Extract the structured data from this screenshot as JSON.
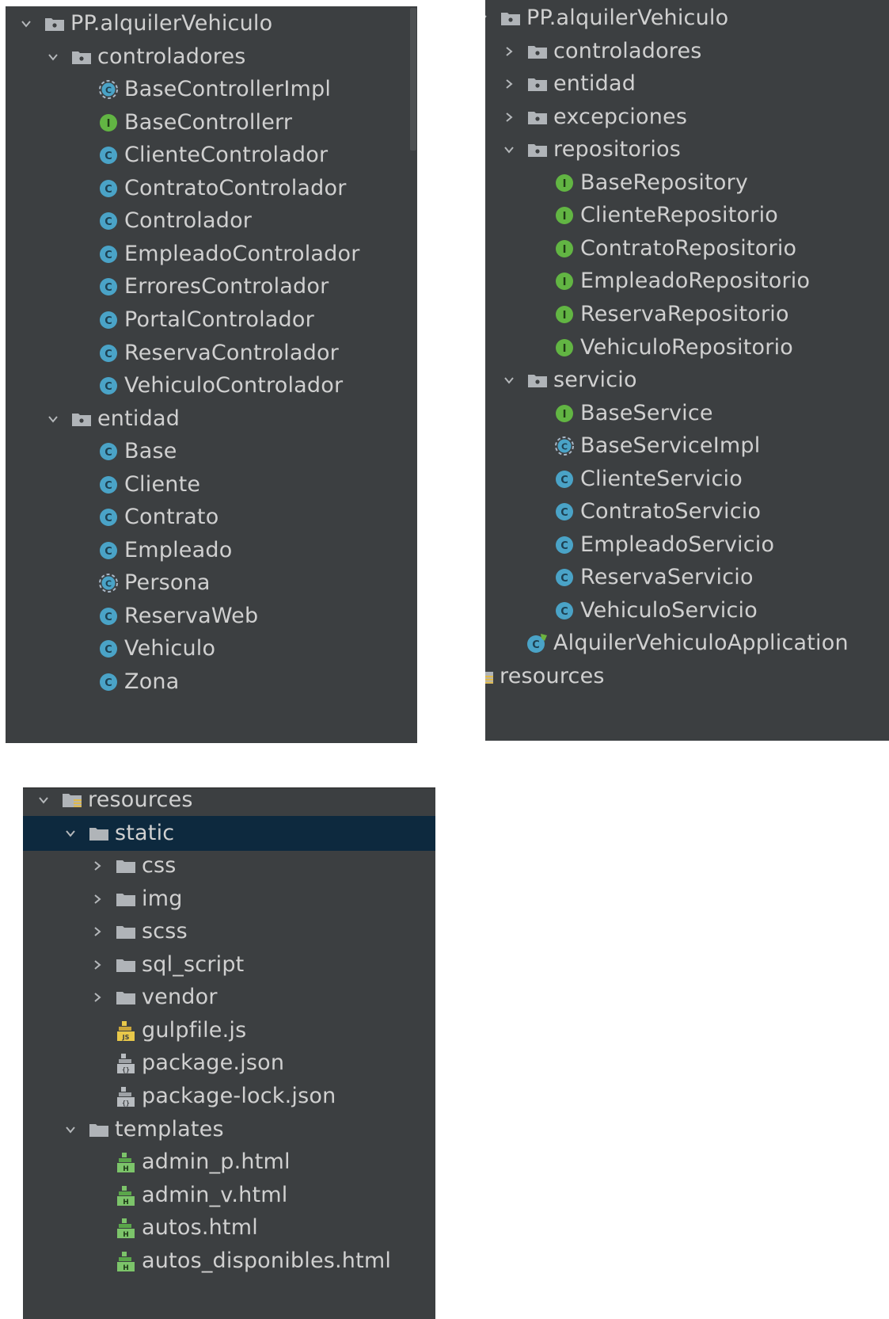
{
  "panels": {
    "left": [
      {
        "label": "PP.alquilerVehiculo",
        "icon": "package-folder-icon",
        "arrow": "down",
        "depth": 0
      },
      {
        "label": "controladores",
        "icon": "package-folder-icon",
        "arrow": "down",
        "depth": 1
      },
      {
        "label": "BaseControllerImpl",
        "icon": "abstract-class-icon",
        "arrow": "",
        "depth": 2
      },
      {
        "label": "BaseControllerr",
        "icon": "interface-icon",
        "arrow": "",
        "depth": 2
      },
      {
        "label": "ClienteControlador",
        "icon": "class-icon",
        "arrow": "",
        "depth": 2
      },
      {
        "label": "ContratoControlador",
        "icon": "class-icon",
        "arrow": "",
        "depth": 2
      },
      {
        "label": "Controlador",
        "icon": "class-icon",
        "arrow": "",
        "depth": 2
      },
      {
        "label": "EmpleadoControlador",
        "icon": "class-icon",
        "arrow": "",
        "depth": 2
      },
      {
        "label": "ErroresControlador",
        "icon": "class-icon",
        "arrow": "",
        "depth": 2
      },
      {
        "label": "PortalControlador",
        "icon": "class-icon",
        "arrow": "",
        "depth": 2
      },
      {
        "label": "ReservaControlador",
        "icon": "class-icon",
        "arrow": "",
        "depth": 2
      },
      {
        "label": "VehiculoControlador",
        "icon": "class-icon",
        "arrow": "",
        "depth": 2
      },
      {
        "label": "entidad",
        "icon": "package-folder-icon",
        "arrow": "down",
        "depth": 1
      },
      {
        "label": "Base",
        "icon": "class-icon",
        "arrow": "",
        "depth": 2
      },
      {
        "label": "Cliente",
        "icon": "class-icon",
        "arrow": "",
        "depth": 2
      },
      {
        "label": "Contrato",
        "icon": "class-icon",
        "arrow": "",
        "depth": 2
      },
      {
        "label": "Empleado",
        "icon": "class-icon",
        "arrow": "",
        "depth": 2
      },
      {
        "label": "Persona",
        "icon": "abstract-class-icon",
        "arrow": "",
        "depth": 2
      },
      {
        "label": "ReservaWeb",
        "icon": "class-icon",
        "arrow": "",
        "depth": 2
      },
      {
        "label": "Vehiculo",
        "icon": "class-icon",
        "arrow": "",
        "depth": 2
      },
      {
        "label": "Zona",
        "icon": "class-icon",
        "arrow": "",
        "depth": 2
      }
    ],
    "right": [
      {
        "label": "PP.alquilerVehiculo",
        "icon": "package-folder-icon",
        "arrow": "down",
        "depth": 0
      },
      {
        "label": "controladores",
        "icon": "package-folder-icon",
        "arrow": "right",
        "depth": 1
      },
      {
        "label": "entidad",
        "icon": "package-folder-icon",
        "arrow": "right",
        "depth": 1
      },
      {
        "label": "excepciones",
        "icon": "package-folder-icon",
        "arrow": "right",
        "depth": 1
      },
      {
        "label": "repositorios",
        "icon": "package-folder-icon",
        "arrow": "down",
        "depth": 1
      },
      {
        "label": "BaseRepository",
        "icon": "interface-icon",
        "arrow": "",
        "depth": 2
      },
      {
        "label": "ClienteRepositorio",
        "icon": "interface-icon",
        "arrow": "",
        "depth": 2
      },
      {
        "label": "ContratoRepositorio",
        "icon": "interface-icon",
        "arrow": "",
        "depth": 2
      },
      {
        "label": "EmpleadoRepositorio",
        "icon": "interface-icon",
        "arrow": "",
        "depth": 2
      },
      {
        "label": "ReservaRepositorio",
        "icon": "interface-icon",
        "arrow": "",
        "depth": 2
      },
      {
        "label": "VehiculoRepositorio",
        "icon": "interface-icon",
        "arrow": "",
        "depth": 2
      },
      {
        "label": "servicio",
        "icon": "package-folder-icon",
        "arrow": "down",
        "depth": 1
      },
      {
        "label": "BaseService",
        "icon": "interface-icon",
        "arrow": "",
        "depth": 2
      },
      {
        "label": "BaseServiceImpl",
        "icon": "abstract-class-icon",
        "arrow": "",
        "depth": 2
      },
      {
        "label": "ClienteServicio",
        "icon": "class-icon",
        "arrow": "",
        "depth": 2
      },
      {
        "label": "ContratoServicio",
        "icon": "class-icon",
        "arrow": "",
        "depth": 2
      },
      {
        "label": "EmpleadoServicio",
        "icon": "class-icon",
        "arrow": "",
        "depth": 2
      },
      {
        "label": "ReservaServicio",
        "icon": "class-icon",
        "arrow": "",
        "depth": 2
      },
      {
        "label": "VehiculoServicio",
        "icon": "class-icon",
        "arrow": "",
        "depth": 2
      },
      {
        "label": "AlquilerVehiculoApplication",
        "icon": "spring-app-class-icon",
        "arrow": "",
        "depth": 1
      },
      {
        "label": "resources",
        "icon": "resources-folder-icon",
        "arrow": "",
        "depth": -1
      }
    ],
    "bottom": [
      {
        "label": "resources",
        "icon": "resources-folder-icon",
        "arrow": "down",
        "depth": 0
      },
      {
        "label": "static",
        "icon": "folder-icon",
        "arrow": "down",
        "depth": 1,
        "selected": true
      },
      {
        "label": "css",
        "icon": "folder-icon",
        "arrow": "right",
        "depth": 2
      },
      {
        "label": "img",
        "icon": "folder-icon",
        "arrow": "right",
        "depth": 2
      },
      {
        "label": "scss",
        "icon": "folder-icon",
        "arrow": "right",
        "depth": 2
      },
      {
        "label": "sql_script",
        "icon": "folder-icon",
        "arrow": "right",
        "depth": 2
      },
      {
        "label": "vendor",
        "icon": "folder-icon",
        "arrow": "right",
        "depth": 2
      },
      {
        "label": "gulpfile.js",
        "icon": "js-file-icon",
        "arrow": "",
        "depth": 2
      },
      {
        "label": "package.json",
        "icon": "json-file-icon",
        "arrow": "",
        "depth": 2
      },
      {
        "label": "package-lock.json",
        "icon": "json-file-icon",
        "arrow": "",
        "depth": 2
      },
      {
        "label": "templates",
        "icon": "folder-icon",
        "arrow": "down",
        "depth": 1
      },
      {
        "label": "admin_p.html",
        "icon": "html-file-icon",
        "arrow": "",
        "depth": 2
      },
      {
        "label": "admin_v.html",
        "icon": "html-file-icon",
        "arrow": "",
        "depth": 2
      },
      {
        "label": "autos.html",
        "icon": "html-file-icon",
        "arrow": "",
        "depth": 2
      },
      {
        "label": "autos_disponibles.html",
        "icon": "html-file-icon",
        "arrow": "",
        "depth": 2
      }
    ]
  },
  "colors": {
    "panel_bg": "#3c3f41",
    "text": "#d0d0d0",
    "selected_bg": "#0d293e",
    "class_icon": "#4aa3c7",
    "interface_icon": "#62b543",
    "folder_icon": "#b0b4b8"
  }
}
